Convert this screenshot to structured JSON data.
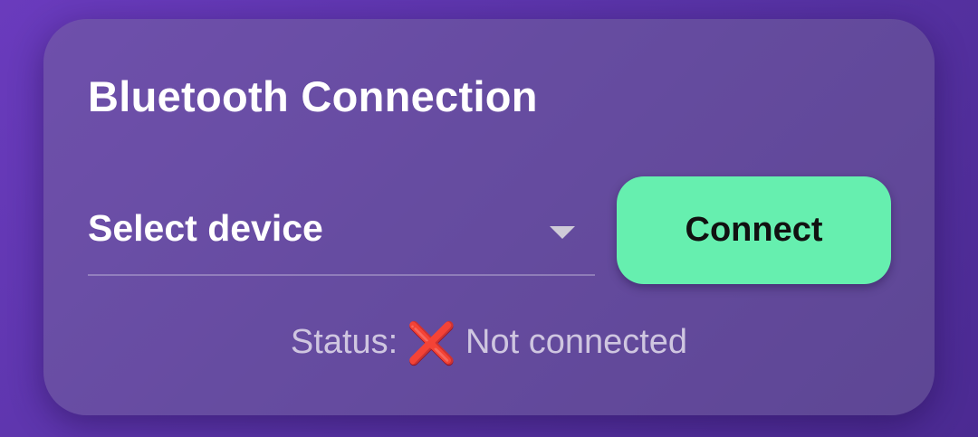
{
  "card": {
    "title": "Bluetooth Connection"
  },
  "device_select": {
    "selected_value": "Select device",
    "icon": "dropdown-arrow-icon"
  },
  "connect_button": {
    "label": "Connect",
    "background_color": "#66efaf"
  },
  "status": {
    "label": "Status:",
    "icon": "cross-mark-icon",
    "icon_glyph": "❌",
    "text": "Not connected",
    "icon_color": "#d8253a"
  }
}
